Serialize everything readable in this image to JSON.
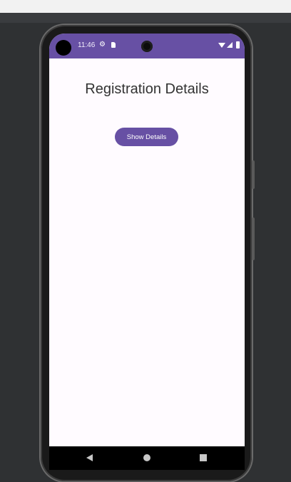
{
  "status_bar": {
    "time": "11:46",
    "icons": [
      "gear-icon",
      "sd-card-icon",
      "wifi-icon",
      "signal-icon",
      "battery-icon"
    ]
  },
  "app": {
    "title": "Registration Details",
    "show_details_button": "Show Details"
  },
  "nav_bar": {
    "icons": [
      "back-icon",
      "home-icon",
      "recents-icon"
    ]
  },
  "colors": {
    "accent": "#6750a4",
    "screen_background": "#fffbff",
    "desktop_background": "#2f3133"
  }
}
